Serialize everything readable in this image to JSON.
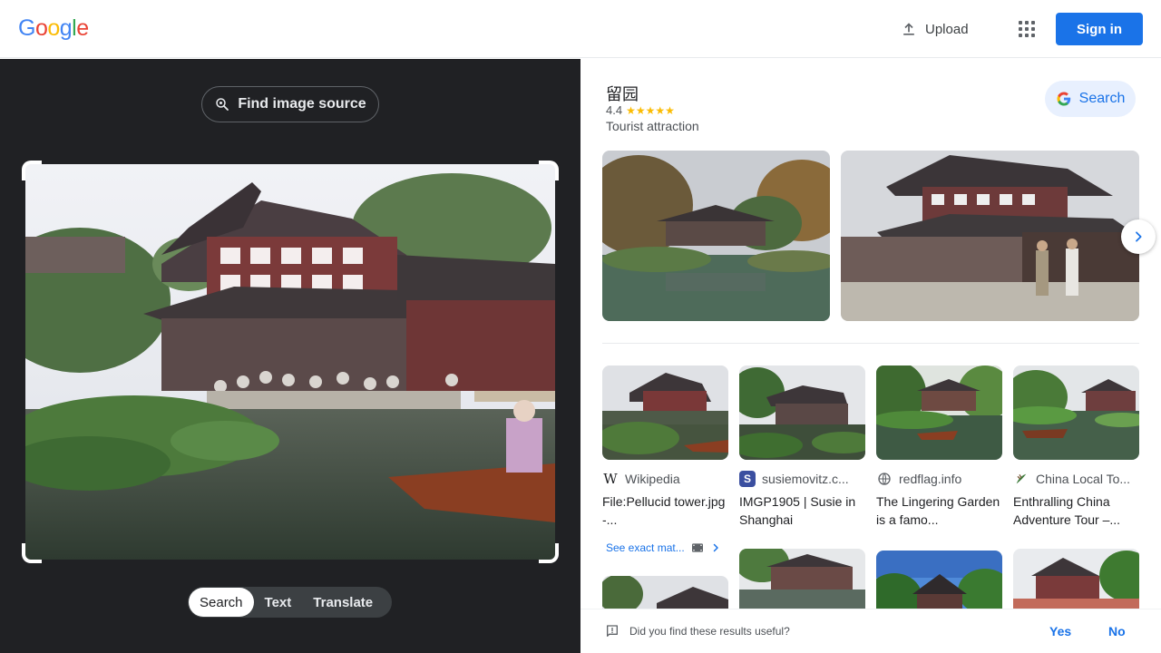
{
  "header": {
    "logo_letters": [
      "G",
      "o",
      "o",
      "g",
      "l",
      "e"
    ],
    "logo_colors": [
      "#4285F4",
      "#EA4335",
      "#FBBC05",
      "#4285F4",
      "#34A853",
      "#EA4335"
    ],
    "upload_label": "Upload",
    "upload_icon": "upload-icon",
    "apps_icon": "apps-grid-icon",
    "signin_label": "Sign in"
  },
  "left_panel": {
    "find_source_label": "Find image source",
    "find_source_icon": "lens-search-icon",
    "modes": [
      {
        "label": "Search",
        "active": true
      },
      {
        "label": "Text",
        "active": false
      },
      {
        "label": "Translate",
        "active": false
      }
    ]
  },
  "knowledge_panel": {
    "title": "留园",
    "rating": "4.4",
    "stars": "★★★★★",
    "type": "Tourist attraction",
    "search_label": "Search",
    "search_icon": "google-g-icon",
    "next_icon": "chevron-right-icon"
  },
  "results": [
    {
      "source": "Wikipedia",
      "source_icon": "wikipedia-w-icon",
      "title": "File:Pellucid tower.jpg -..."
    },
    {
      "source": "susiemovitz.c...",
      "source_icon": "s-favicon-icon",
      "title": "IMGP1905 | Susie in Shanghai"
    },
    {
      "source": "redflag.info",
      "source_icon": "globe-icon",
      "title": "The Lingering Garden is a famo..."
    },
    {
      "source": "China Local To...",
      "source_icon": "china-local-favicon-icon",
      "title": "Enthralling China Adventure Tour –..."
    }
  ],
  "see_exact": {
    "label": "See exact mat...",
    "icon": "film-icon"
  },
  "feedback": {
    "question": "Did you find these results useful?",
    "yes_label": "Yes",
    "no_label": "No",
    "icon": "feedback-icon"
  },
  "colors": {
    "accent": "#1a73e8",
    "dark_panel": "#202124",
    "star": "#fbbc04"
  }
}
